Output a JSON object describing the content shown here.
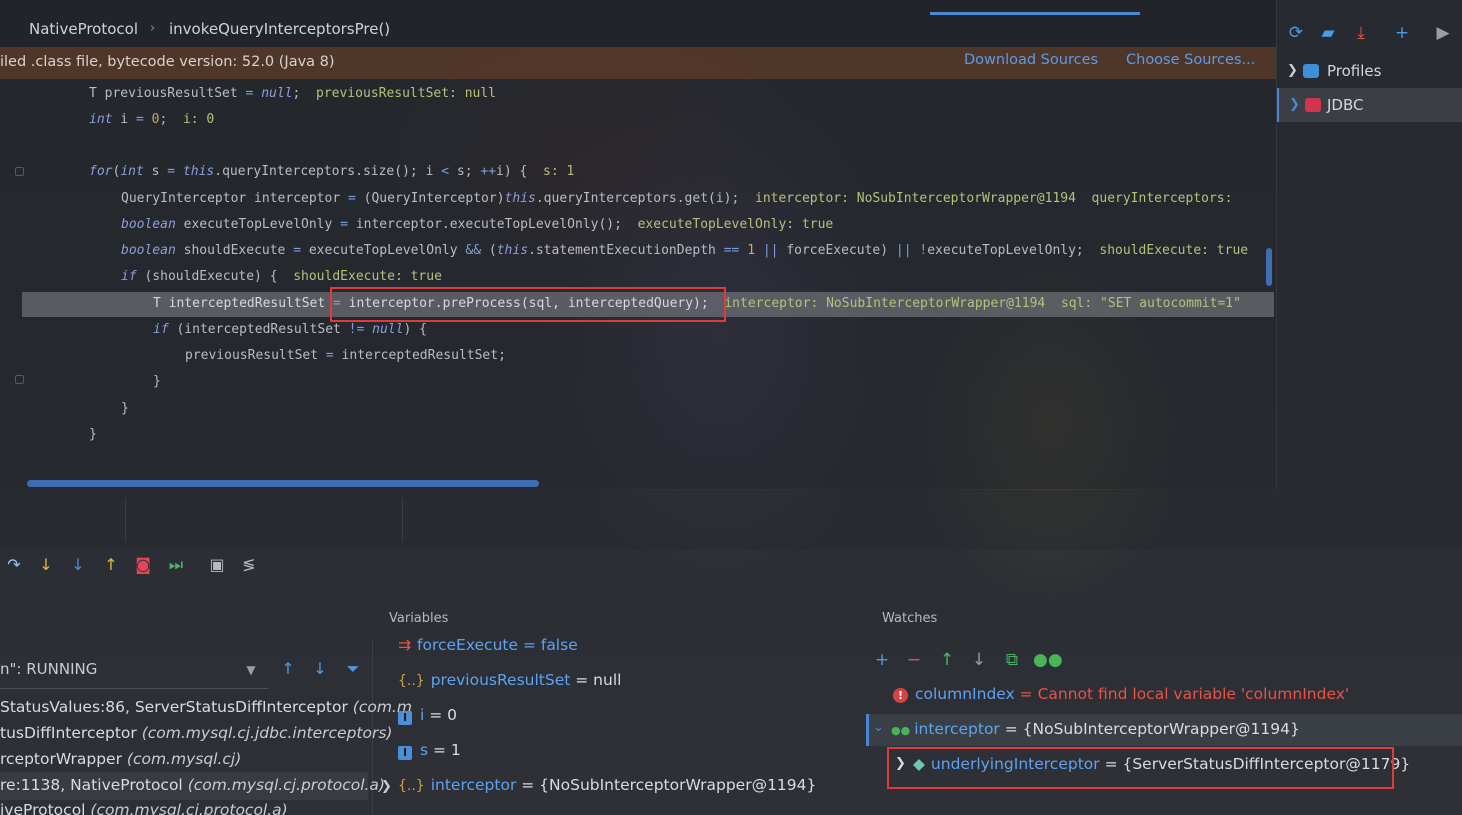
{
  "breadcrumb": {
    "items": [
      "NativeProtocol",
      "invokeQueryInterceptorsPre()"
    ],
    "separator": "›"
  },
  "notice": {
    "text": "iled .class file, bytecode version: 52.0 (Java 8)",
    "download_sources": "Download Sources",
    "choose_sources": "Choose Sources..."
  },
  "editor": {
    "lines": [
      {
        "code": "T previousResultSet = null;",
        "hint": "previousResultSet: null"
      },
      {
        "code": "int i = 0;",
        "hint": "i: 0"
      },
      {
        "code": "for(int s = this.queryInterceptors.size(); i < s; ++i) {",
        "hint": "s: 1"
      },
      {
        "code": "QueryInterceptor interceptor = (QueryInterceptor)this.queryInterceptors.get(i);",
        "hint": "interceptor: NoSubInterceptorWrapper@1194  queryInterceptors:"
      },
      {
        "code": "boolean executeTopLevelOnly = interceptor.executeTopLevelOnly();",
        "hint": "executeTopLevelOnly: true"
      },
      {
        "code": "boolean shouldExecute = executeTopLevelOnly && (this.statementExecutionDepth == 1 || forceExecute) || !executeTopLevelOnly;",
        "hint": "shouldExecute: true"
      },
      {
        "code": "if (shouldExecute) {",
        "hint": "shouldExecute: true"
      },
      {
        "code": "T interceptedResultSet = interceptor.preProcess(sql, interceptedQuery);",
        "hint": "interceptor: NoSubInterceptorWrapper@1194  sql: \"SET autocommit=1\""
      },
      {
        "code": "if (interceptedResultSet != null) {",
        "hint": ""
      },
      {
        "code": "previousResultSet = interceptedResultSet;",
        "hint": ""
      },
      {
        "code": "}",
        "hint": ""
      },
      {
        "code": "}",
        "hint": ""
      },
      {
        "code": "}",
        "hint": ""
      }
    ]
  },
  "right_panel": {
    "tree": [
      {
        "label": "Profiles",
        "selected": false
      },
      {
        "label": "JDBC",
        "selected": true
      }
    ],
    "tools": [
      "refresh-icon",
      "folder-sync-icon",
      "download-icon",
      "add-icon",
      "run-icon"
    ]
  },
  "debugger": {
    "toolbar": [
      "step-over-icon",
      "step-into-icon",
      "force-step-into-icon",
      "step-out-icon",
      "drop-frame-icon",
      "run-to-cursor-icon",
      "evaluate-expression-icon",
      "trace-icon"
    ],
    "frames_panel": {
      "thread": "n\": RUNNING",
      "frames": [
        {
          "method": "StatusValues:86, ServerStatusDiffInterceptor",
          "pkg": "(com.m"
        },
        {
          "method": "tusDiffInterceptor",
          "pkg": "(com.mysql.cj.jdbc.interceptors)"
        },
        {
          "method": "rceptorWrapper",
          "pkg": "(com.mysql.cj)"
        },
        {
          "method": "re:1138, NativeProtocol",
          "pkg": "(com.mysql.cj.protocol.a)"
        },
        {
          "method": "iveProtocol",
          "pkg": "(com.mysql.cj.protocol.a)"
        }
      ]
    },
    "variables_panel": {
      "title": "Variables",
      "clipped_top": "forceExecute = false",
      "rows": [
        {
          "icon": "{..}",
          "name": "previousResultSet",
          "value": " = null"
        },
        {
          "icon": "I",
          "name": "i",
          "value": " = 0"
        },
        {
          "icon": "I",
          "name": "s",
          "value": " = 1"
        },
        {
          "icon": "{..}",
          "name": "interceptor",
          "value": " = {NoSubInterceptorWrapper@1194}"
        }
      ]
    },
    "watches_panel": {
      "title": "Watches",
      "rows": [
        {
          "name": "columnIndex",
          "eq": " = ",
          "value": "Cannot find local variable 'columnIndex'"
        },
        {
          "name": "interceptor",
          "eq": " = ",
          "value": "{NoSubInterceptorWrapper@1194}"
        },
        {
          "name": "underlyingInterceptor",
          "eq": " = ",
          "value": "{ServerStatusDiffInterceptor@1179}"
        }
      ]
    }
  },
  "colors": {
    "accent": "#4a88d6",
    "link": "#5a9be8",
    "error": "#e8524a",
    "highlight_box": "#e03a3a",
    "inline_hint": "#b7c07a"
  }
}
